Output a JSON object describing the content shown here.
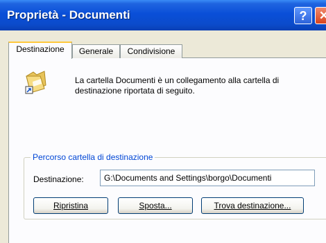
{
  "window": {
    "title": "Proprietà - Documenti",
    "help_label": "?",
    "close_label": "✕"
  },
  "tabs": [
    {
      "label": "Destinazione",
      "active": true
    },
    {
      "label": "Generale",
      "active": false
    },
    {
      "label": "Condivisione",
      "active": false
    }
  ],
  "destination_tab": {
    "icon": "folder-shortcut-icon",
    "description": "La cartella Documenti è un collegamento alla cartella di destinazione riportata di seguito.",
    "group_title": "Percorso cartella di destinazione",
    "destination_label": "Destinazione:",
    "destination_value": "G:\\Documents and Settings\\borgo\\Documenti",
    "buttons": {
      "restore": "Ripristina",
      "move": "Sposta...",
      "find": "Trova destinazione..."
    }
  },
  "colors": {
    "titlebar": "#0A4FD8",
    "tab_accent": "#FFC83C",
    "group_label": "#0046D5"
  }
}
